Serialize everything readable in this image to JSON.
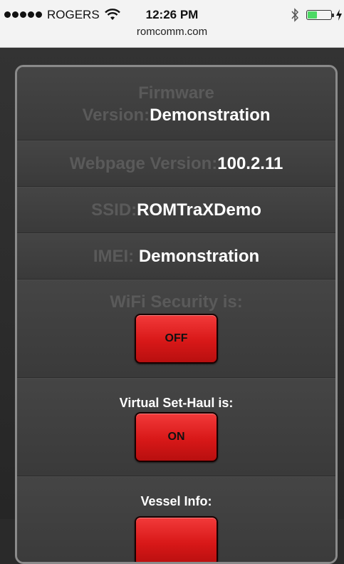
{
  "status_bar": {
    "carrier": "ROGERS",
    "time": "12:26 PM",
    "url": "romcomm.com",
    "battery_level": 0.38,
    "icons": [
      "signal-dots-icon",
      "wifi-icon",
      "bluetooth-icon",
      "battery-icon",
      "charging-icon"
    ]
  },
  "info": {
    "firmware_label_1": "Firmware",
    "firmware_label_2": "Version:",
    "firmware_value": "Demonstration",
    "webpage_label": "Webpage Version:",
    "webpage_value": "100.2.11",
    "ssid_label": "SSID:",
    "ssid_value": "ROMTraXDemo",
    "imei_label": "IMEI: ",
    "imei_value": "Demonstration"
  },
  "toggles": {
    "wifi_security_label": "WiFi Security is:",
    "wifi_security_state": "OFF",
    "virtual_set_haul_label": "Virtual Set-Haul is:",
    "virtual_set_haul_state": "ON",
    "vessel_info_label": "Vessel Info:",
    "vessel_info_button": ""
  },
  "colors": {
    "button_red": "#d81818",
    "panel_border": "#8a8a8a",
    "dim_text": "#5a5a5a"
  }
}
